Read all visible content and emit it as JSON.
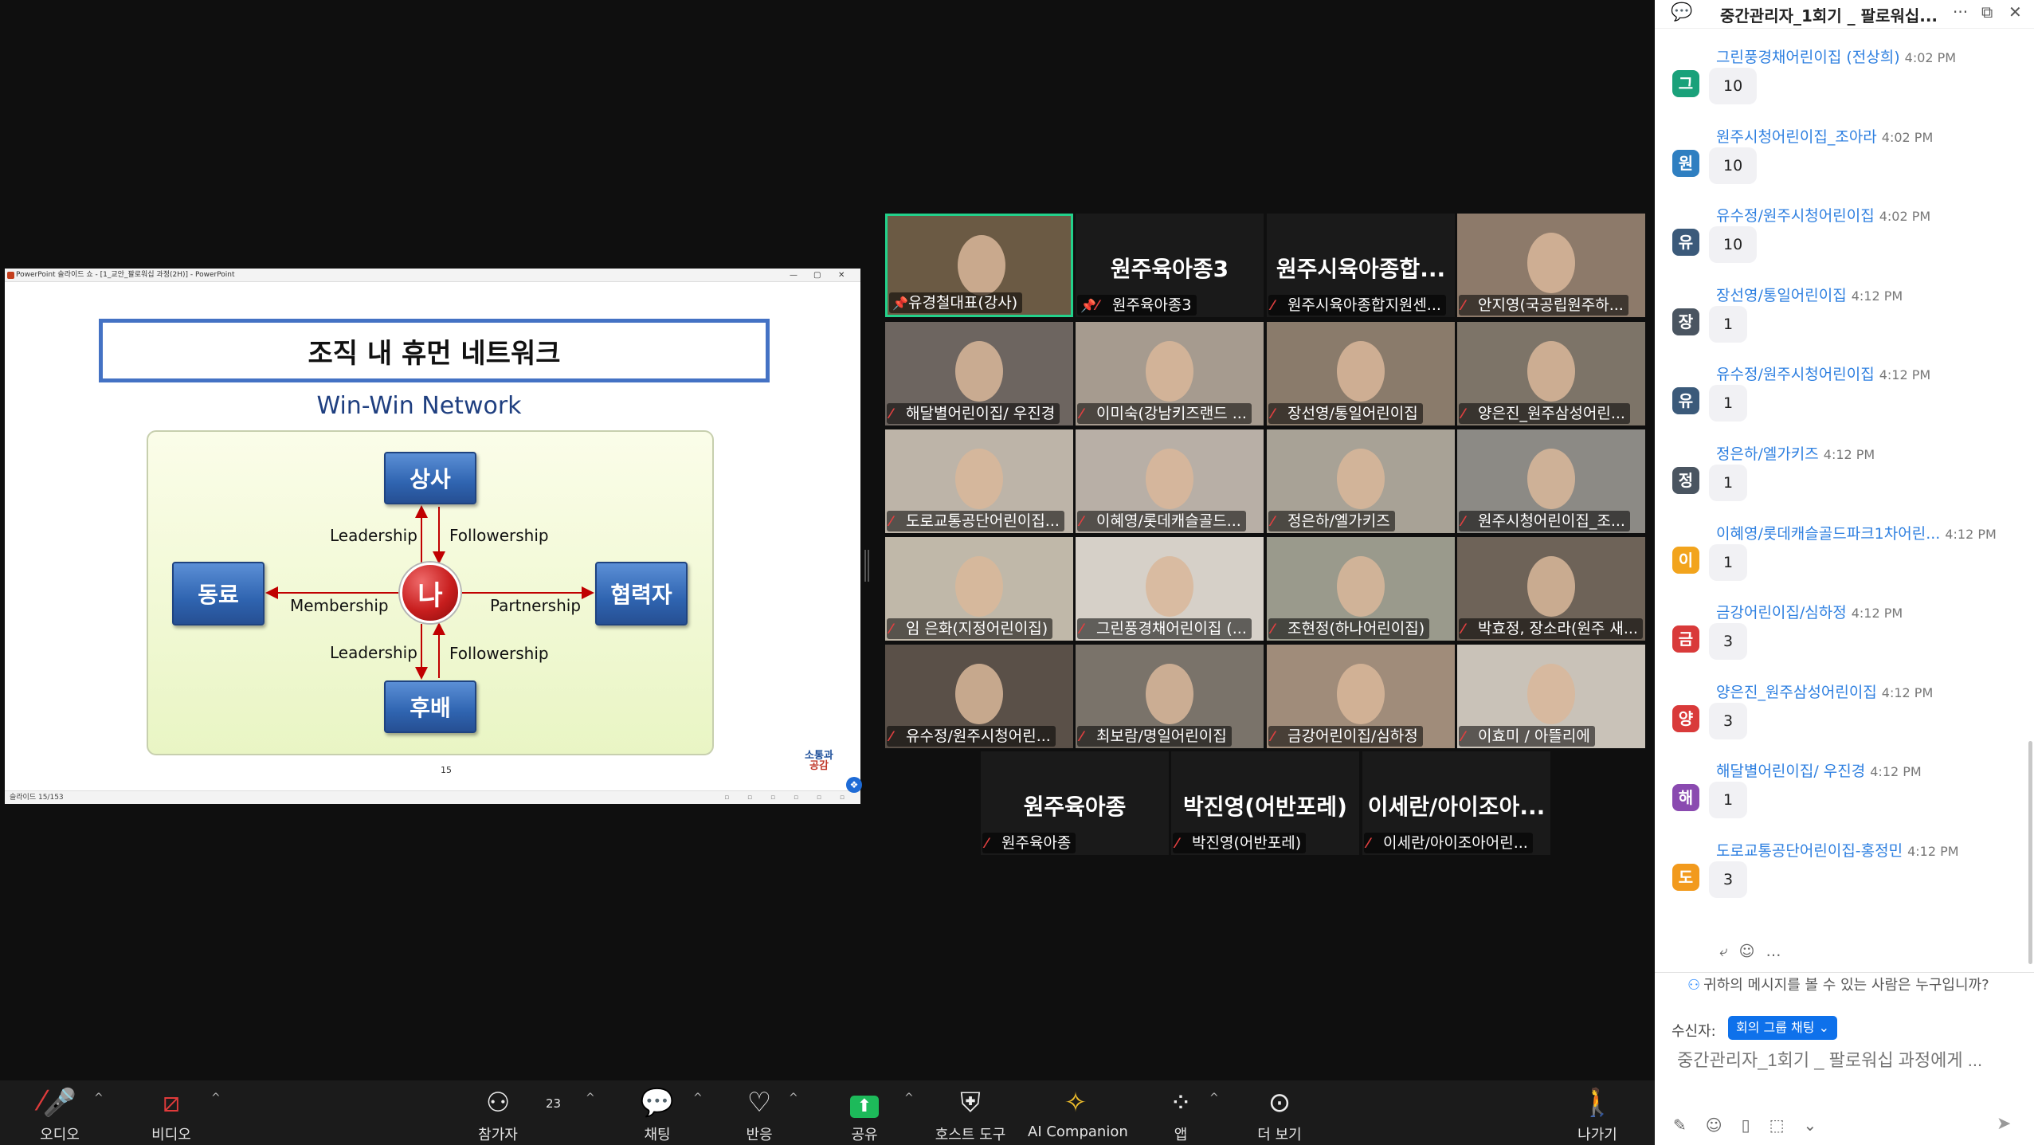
{
  "slide": {
    "titlebar": "PowerPoint 슬라이드 쇼 - [1_교안_팔로워십 과정(2H)] - PowerPoint",
    "win_min": "—",
    "win_max": "▢",
    "win_close": "✕",
    "title": "조직 내 휴먼 네트워크",
    "subtitle": "Win-Win Network",
    "center": "나",
    "boss": "상사",
    "junior": "후배",
    "peer": "동료",
    "partner": "협력자",
    "label_leadership_top": "Leadership",
    "label_followership_top": "Followership",
    "label_leadership_bottom": "Leadership",
    "label_followership_bottom": "Followership",
    "label_membership": "Membership",
    "label_partnership": "Partnership",
    "page_number": "15",
    "logo_line1": "소통과",
    "logo_line2": "공감",
    "status": "슬라이드 15/153"
  },
  "participants": [
    {
      "name": "유경철대표(강사)",
      "pinned": true,
      "muted": false,
      "center": ""
    },
    {
      "name": "원주육아종3",
      "pinned": true,
      "muted": true,
      "center": "원주육아종3"
    },
    {
      "name": "원주시육아종합지원센...",
      "pinned": false,
      "muted": true,
      "center": "원주시육아종합..."
    },
    {
      "name": "안지영(국공립원주하...",
      "pinned": false,
      "muted": true,
      "center": ""
    },
    {
      "name": "해달별어린이집/ 우진경",
      "pinned": false,
      "muted": true,
      "center": ""
    },
    {
      "name": "이미숙(강남키즈랜드 ...",
      "pinned": false,
      "muted": true,
      "center": ""
    },
    {
      "name": "장선영/통일어린이집",
      "pinned": false,
      "muted": true,
      "center": ""
    },
    {
      "name": "양은진_원주삼성어린...",
      "pinned": false,
      "muted": true,
      "center": ""
    },
    {
      "name": "도로교통공단어린이집...",
      "pinned": false,
      "muted": true,
      "center": ""
    },
    {
      "name": "이혜영/롯데캐슬골드...",
      "pinned": false,
      "muted": true,
      "center": ""
    },
    {
      "name": "정은하/엘가키즈",
      "pinned": false,
      "muted": true,
      "center": ""
    },
    {
      "name": "원주시청어린이집_조...",
      "pinned": false,
      "muted": true,
      "center": ""
    },
    {
      "name": "임 은화(지정어린이집)",
      "pinned": false,
      "muted": true,
      "center": ""
    },
    {
      "name": "그린풍경채어린이집 (...",
      "pinned": false,
      "muted": true,
      "center": ""
    },
    {
      "name": "조현정(하나어린이집)",
      "pinned": false,
      "muted": true,
      "center": ""
    },
    {
      "name": "박효정, 장소라(원주 새...",
      "pinned": false,
      "muted": true,
      "center": ""
    },
    {
      "name": "유수정/원주시청어린...",
      "pinned": false,
      "muted": true,
      "center": ""
    },
    {
      "name": "최보람/명일어린이집",
      "pinned": false,
      "muted": true,
      "center": ""
    },
    {
      "name": "금강어린이집/심하정",
      "pinned": false,
      "muted": true,
      "center": ""
    },
    {
      "name": "이효미 / 아뜰리에",
      "pinned": false,
      "muted": true,
      "center": ""
    },
    {
      "name": "원주육아종",
      "pinned": false,
      "muted": true,
      "center": "원주육아종"
    },
    {
      "name": "박진영(어반포레)",
      "pinned": false,
      "muted": true,
      "center": "박진영(어반포레)"
    },
    {
      "name": "이세란/아이조아어린...",
      "pinned": false,
      "muted": true,
      "center": "이세란/아이조아..."
    }
  ],
  "chat": {
    "title": "중간관리자_1회기 _ 팔로워십...",
    "messages": [
      {
        "initial": "그",
        "color": "#1aa17a",
        "sender": "그린풍경채어린이집 (전상희)",
        "time": "4:02 PM",
        "text": "10"
      },
      {
        "initial": "원",
        "color": "#2f7fc1",
        "sender": "원주시청어린이집_조아라",
        "time": "4:02 PM",
        "text": "10"
      },
      {
        "initial": "유",
        "color": "#3b5a7a",
        "sender": "유수정/원주시청어린이집",
        "time": "4:02 PM",
        "text": "10"
      },
      {
        "initial": "장",
        "color": "#4a5561",
        "sender": "장선영/통일어린이집",
        "time": "4:12 PM",
        "text": "1"
      },
      {
        "initial": "유",
        "color": "#3b5a7a",
        "sender": "유수정/원주시청어린이집",
        "time": "4:12 PM",
        "text": "1"
      },
      {
        "initial": "정",
        "color": "#4a5561",
        "sender": "정은하/엘가키즈",
        "time": "4:12 PM",
        "text": "1"
      },
      {
        "initial": "이",
        "color": "#f2a41d",
        "sender": "이혜영/롯데캐슬골드파크1차어린...",
        "time": "4:12 PM",
        "text": "1"
      },
      {
        "initial": "금",
        "color": "#d93a3a",
        "sender": "금강어린이집/심하정",
        "time": "4:12 PM",
        "text": "3"
      },
      {
        "initial": "양",
        "color": "#d93a3a",
        "sender": "양은진_원주삼성어린이집",
        "time": "4:12 PM",
        "text": "3"
      },
      {
        "initial": "해",
        "color": "#8a4ab0",
        "sender": "해달별어린이집/ 우진경",
        "time": "4:12 PM",
        "text": "1"
      },
      {
        "initial": "도",
        "color": "#f29a1d",
        "sender": "도로교통공단어린이집-홍정민",
        "time": "4:12 PM",
        "text": "3"
      }
    ],
    "who_can_see": "귀하의 메시지를 볼 수 있는 사람은 누구입니까?",
    "to_label": "수신자:",
    "to_value": "회의 그룹 채팅 ⌄",
    "input_placeholder": "중간관리자_1회기 _ 팔로워십 과정에게 ..."
  },
  "toolbar": {
    "audio": "오디오",
    "video": "비디오",
    "participants": "참가자",
    "participants_count": "23",
    "chat": "채팅",
    "reactions": "반응",
    "share": "공유",
    "host_tools": "호스트 도구",
    "ai_companion": "AI Companion",
    "apps": "앱",
    "more": "더 보기",
    "leave": "나가기"
  }
}
